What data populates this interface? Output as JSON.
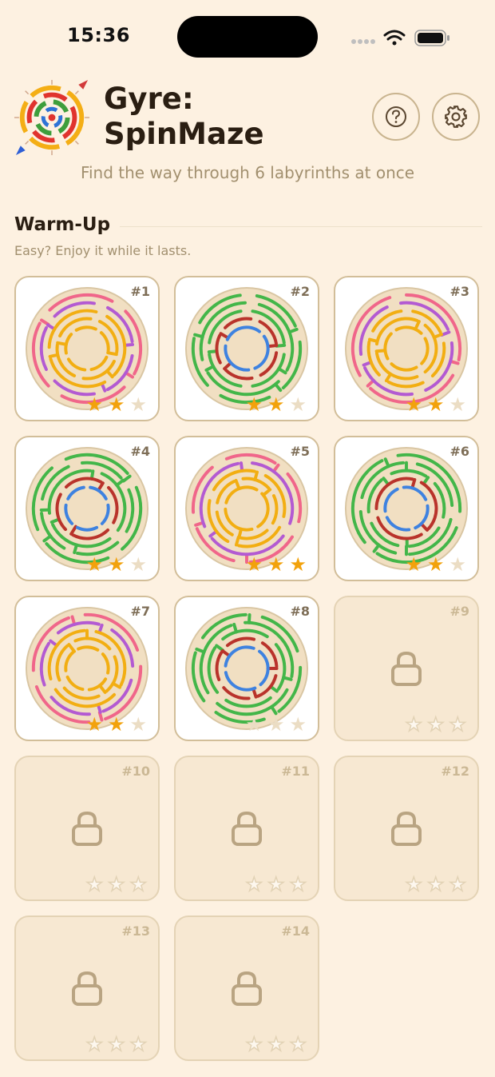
{
  "status": {
    "time": "15:36"
  },
  "header": {
    "title_line1": "Gyre:",
    "title_line2": "SpinMaze",
    "subtitle": "Find the way through 6 labyrinths at once",
    "help_icon": "question-icon",
    "settings_icon": "gear-icon"
  },
  "section": {
    "title": "Warm-Up",
    "subtitle": "Easy? Enjoy it while it lasts."
  },
  "colors": {
    "background": "#FDF1E1",
    "star_on": "#F2A20C",
    "pink": "#F0668A",
    "purple": "#B35AD2",
    "yellow": "#F2AE12",
    "green": "#43B649",
    "red": "#B9332B",
    "blue": "#3E82E0"
  },
  "levels": [
    {
      "label": "#1",
      "stars": 2,
      "locked": false,
      "palette": "warm"
    },
    {
      "label": "#2",
      "stars": 2,
      "locked": false,
      "palette": "cool"
    },
    {
      "label": "#3",
      "stars": 2,
      "locked": false,
      "palette": "warm"
    },
    {
      "label": "#4",
      "stars": 2,
      "locked": false,
      "palette": "cool"
    },
    {
      "label": "#5",
      "stars": 3,
      "locked": false,
      "palette": "warm"
    },
    {
      "label": "#6",
      "stars": 2,
      "locked": false,
      "palette": "cool"
    },
    {
      "label": "#7",
      "stars": 2,
      "locked": false,
      "palette": "warm"
    },
    {
      "label": "#8",
      "stars": 0,
      "locked": false,
      "palette": "cool"
    },
    {
      "label": "#9",
      "stars": 0,
      "locked": true
    },
    {
      "label": "#10",
      "stars": 0,
      "locked": true
    },
    {
      "label": "#11",
      "stars": 0,
      "locked": true
    },
    {
      "label": "#12",
      "stars": 0,
      "locked": true
    },
    {
      "label": "#13",
      "stars": 0,
      "locked": true
    },
    {
      "label": "#14",
      "stars": 0,
      "locked": true
    }
  ]
}
